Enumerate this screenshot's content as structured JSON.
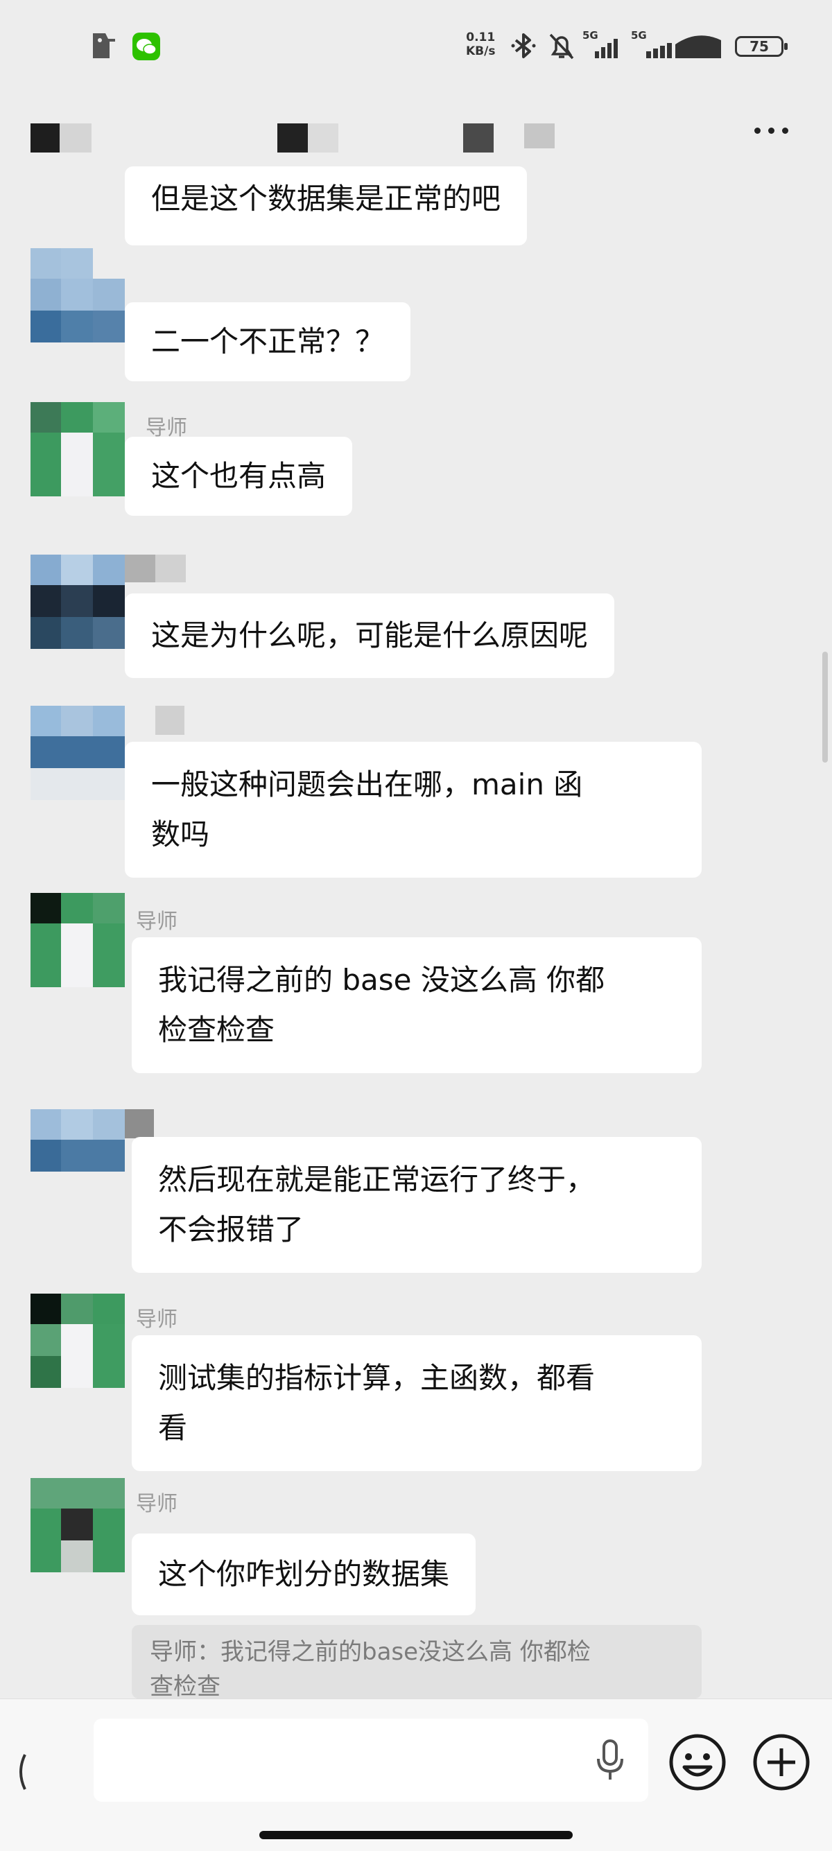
{
  "status_bar": {
    "net_speed_value": "0.11",
    "net_speed_unit": "KB/s",
    "network_label_1": "5G",
    "network_label_2": "5G",
    "battery": "75",
    "icons": [
      "hat-icon",
      "wechat-icon",
      "bluetooth-icon",
      "bell-off-icon",
      "signal-icon",
      "wifi-icon",
      "battery-icon"
    ]
  },
  "header": {
    "title": "",
    "more_icon": "more-icon"
  },
  "messages": [
    {
      "sender": "",
      "text": "但是这个数据集是正常的吧"
    },
    {
      "sender": "",
      "text": "二一个不正常？？"
    },
    {
      "sender": "导师",
      "text": "这个也有点高"
    },
    {
      "sender": "",
      "text": "这是为什么呢，可能是什么原因呢"
    },
    {
      "sender": "",
      "text_line1": "一般这种问题会出在哪，main 函",
      "text_line2": "数吗"
    },
    {
      "sender": "导师",
      "text_line1": "我记得之前的 base 没这么高 你都",
      "text_line2": "检查检查"
    },
    {
      "sender": "",
      "text_line1": "然后现在就是能正常运行了终于，",
      "text_line2": "不会报错了"
    },
    {
      "sender": "导师",
      "text_line1": "测试集的指标计算，主函数，都看",
      "text_line2": "看"
    },
    {
      "sender": "导师",
      "text": "这个你咋划分的数据集"
    }
  ],
  "quote": {
    "line1": "导师：我记得之前的base没这么高 你都检",
    "line2": "查检查"
  },
  "input_bar": {
    "placeholder": "",
    "icons": [
      "keyboard-voice-icon",
      "mic-icon",
      "emoji-icon",
      "add-icon"
    ]
  },
  "colors": {
    "background": "#ededed",
    "bubble": "#ffffff",
    "mentor_green": "#3d9a5f",
    "student_blue": "#3c6e9a"
  }
}
